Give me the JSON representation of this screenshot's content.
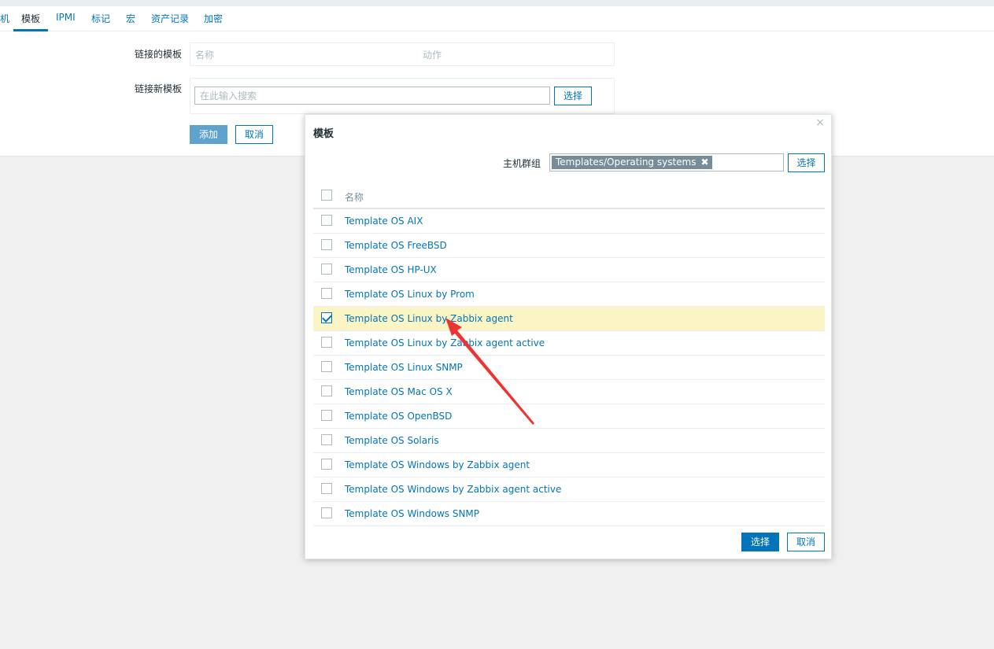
{
  "tabs": [
    "机",
    "模板",
    "IPMI",
    "标记",
    "宏",
    "资产记录",
    "加密"
  ],
  "form": {
    "linked_label": "链接的模板",
    "linked_col_name": "名称",
    "linked_col_action": "动作",
    "new_label": "链接新模板",
    "search_placeholder": "在此输入搜索",
    "select_button": "选择",
    "add_button": "添加",
    "cancel_button": "取消"
  },
  "modal": {
    "title": "模板",
    "close": "×",
    "host_group_label": "主机群组",
    "host_group_chip": "Templates/Operating systems",
    "chip_remove": "✖",
    "select_button": "选择",
    "column_name": "名称",
    "rows": [
      {
        "label": "Template OS AIX",
        "checked": false
      },
      {
        "label": "Template OS FreeBSD",
        "checked": false
      },
      {
        "label": "Template OS HP-UX",
        "checked": false
      },
      {
        "label": "Template OS Linux by Prom",
        "checked": false
      },
      {
        "label": "Template OS Linux by Zabbix agent",
        "checked": true
      },
      {
        "label": "Template OS Linux by Zabbix agent active",
        "checked": false
      },
      {
        "label": "Template OS Linux SNMP",
        "checked": false
      },
      {
        "label": "Template OS Mac OS X",
        "checked": false
      },
      {
        "label": "Template OS OpenBSD",
        "checked": false
      },
      {
        "label": "Template OS Solaris",
        "checked": false
      },
      {
        "label": "Template OS Windows by Zabbix agent",
        "checked": false
      },
      {
        "label": "Template OS Windows by Zabbix agent active",
        "checked": false
      },
      {
        "label": "Template OS Windows SNMP",
        "checked": false
      }
    ],
    "footer_select": "选择",
    "footer_cancel": "取消"
  },
  "colors": {
    "link": "#0275b8",
    "selected_row": "#fbf5c5",
    "annotation_arrow": "#ee3333"
  }
}
